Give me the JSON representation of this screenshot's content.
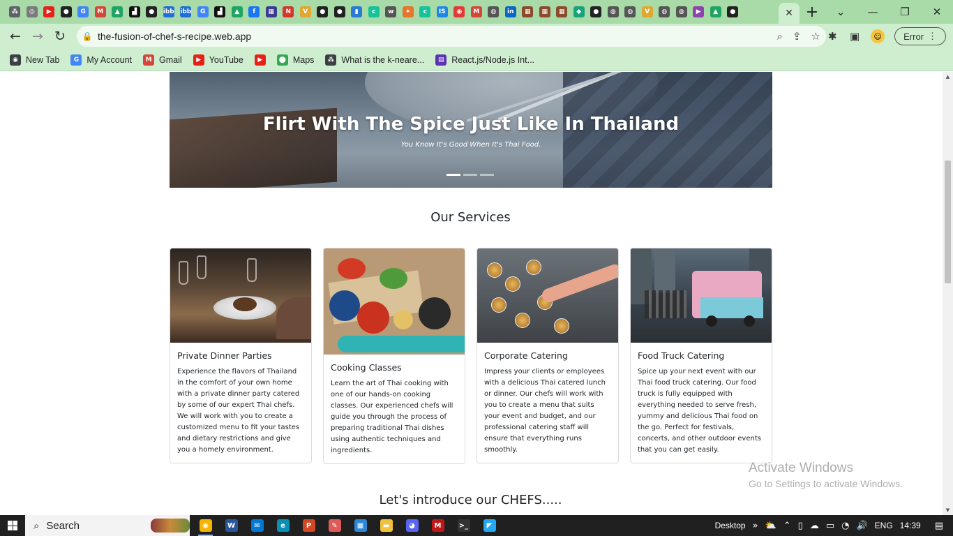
{
  "browser": {
    "url": "the-fusion-of-chef-s-recipe.web.app",
    "profile_button": "Error",
    "tab_icons": [
      {
        "name": "dots-icon",
        "color": "#5f6368",
        "glyph": "⁂"
      },
      {
        "name": "openai-icon",
        "color": "#7a7a7a",
        "glyph": "◎"
      },
      {
        "name": "youtube-icon",
        "color": "#e62117",
        "glyph": "▶"
      },
      {
        "name": "github-icon",
        "color": "#222222",
        "glyph": "●"
      },
      {
        "name": "google-icon",
        "color": "#4285f4",
        "glyph": "G"
      },
      {
        "name": "gmail-icon",
        "color": "#d44638",
        "glyph": "M"
      },
      {
        "name": "drive-icon",
        "color": "#1fa463",
        "glyph": "▲"
      },
      {
        "name": "codeforces-icon",
        "color": "#111111",
        "glyph": "▟"
      },
      {
        "name": "github-icon",
        "color": "#222222",
        "glyph": "●"
      },
      {
        "name": "imgbb-icon",
        "color": "#1f6fd6",
        "glyph": "ibb"
      },
      {
        "name": "imgbb-icon",
        "color": "#1f6fd6",
        "glyph": "ibb"
      },
      {
        "name": "google-icon",
        "color": "#4285f4",
        "glyph": "G"
      },
      {
        "name": "codeforces-icon",
        "color": "#111111",
        "glyph": "▟"
      },
      {
        "name": "drive-icon",
        "color": "#1fa463",
        "glyph": "▲"
      },
      {
        "name": "facebook-icon",
        "color": "#1877f2",
        "glyph": "f"
      },
      {
        "name": "app-icon",
        "color": "#3b3b8f",
        "glyph": "▦"
      },
      {
        "name": "notion-icon",
        "color": "#d6352b",
        "glyph": "N"
      },
      {
        "name": "vercel-icon",
        "color": "#e0a82e",
        "glyph": "V"
      },
      {
        "name": "github-icon",
        "color": "#222222",
        "glyph": "●"
      },
      {
        "name": "github-icon",
        "color": "#222222",
        "glyph": "●"
      },
      {
        "name": "book-icon",
        "color": "#2b7bd6",
        "glyph": "▮"
      },
      {
        "name": "grammarly-icon",
        "color": "#15c39a",
        "glyph": "c"
      },
      {
        "name": "wiki-icon",
        "color": "#555555",
        "glyph": "w"
      },
      {
        "name": "star-icon",
        "color": "#e6742b",
        "glyph": "✶"
      },
      {
        "name": "grammarly-icon",
        "color": "#15c39a",
        "glyph": "c"
      },
      {
        "name": "is-icon",
        "color": "#1e88e5",
        "glyph": "IS"
      },
      {
        "name": "record-icon",
        "color": "#e53935",
        "glyph": "◉"
      },
      {
        "name": "gmail-icon",
        "color": "#d44638",
        "glyph": "M"
      },
      {
        "name": "netlify-icon",
        "color": "#555555",
        "glyph": "◍"
      },
      {
        "name": "linkedin-icon",
        "color": "#0a66c2",
        "glyph": "in"
      },
      {
        "name": "app-icon",
        "color": "#8a4b2b",
        "glyph": "▦"
      },
      {
        "name": "app-icon",
        "color": "#8a4b2b",
        "glyph": "▦"
      },
      {
        "name": "app-icon",
        "color": "#8a4b2b",
        "glyph": "▦"
      },
      {
        "name": "diamond-icon",
        "color": "#1aa37a",
        "glyph": "◆"
      },
      {
        "name": "github-icon",
        "color": "#222222",
        "glyph": "●"
      },
      {
        "name": "netlify-icon",
        "color": "#555555",
        "glyph": "◍"
      },
      {
        "name": "netlify-icon",
        "color": "#555555",
        "glyph": "◍"
      },
      {
        "name": "vercel-icon",
        "color": "#e0a82e",
        "glyph": "V"
      },
      {
        "name": "netlify-icon",
        "color": "#555555",
        "glyph": "◍"
      },
      {
        "name": "netlify-icon",
        "color": "#555555",
        "glyph": "◍"
      },
      {
        "name": "play-icon",
        "color": "#8e44ad",
        "glyph": "▶"
      },
      {
        "name": "drive-icon",
        "color": "#1fa463",
        "glyph": "▲"
      },
      {
        "name": "github-icon",
        "color": "#222222",
        "glyph": "●"
      }
    ],
    "bookmarks": [
      {
        "label": "New Tab",
        "icon": "globe-icon",
        "color": "#3c4043",
        "glyph": "◉"
      },
      {
        "label": "My Account",
        "icon": "google-icon",
        "color": "#4285f4",
        "glyph": "G"
      },
      {
        "label": "Gmail",
        "icon": "gmail-icon",
        "color": "#d44638",
        "glyph": "M"
      },
      {
        "label": "YouTube",
        "icon": "youtube-icon",
        "color": "#e62117",
        "glyph": "▶"
      },
      {
        "label": "",
        "icon": "youtube-icon",
        "color": "#e62117",
        "glyph": "▶"
      },
      {
        "label": "Maps",
        "icon": "maps-icon",
        "color": "#34a853",
        "glyph": "⬤"
      },
      {
        "label": "What is the k-neare...",
        "icon": "network-icon",
        "color": "#3c4043",
        "glyph": "⁂"
      },
      {
        "label": "React.js/Node.js Int...",
        "icon": "app-icon",
        "color": "#5e35b1",
        "glyph": "▤"
      }
    ]
  },
  "hero": {
    "title": "Flirt With The Spice Just Like In Thailand",
    "subtitle": "You Know It's Good When It's Thai Food.",
    "slides": 3,
    "active_slide": 1
  },
  "services": {
    "title": "Our Services",
    "cards": [
      {
        "title": "Private Dinner Parties",
        "text": "Experience the flavors of Thailand in the comfort of your own home with a private dinner party catered by some of our expert Thai chefs. We will work with you to create a customized menu to fit your tastes and dietary restrictions and give you a homely environment."
      },
      {
        "title": "Cooking Classes",
        "text": "Learn the art of Thai cooking with one of our hands-on cooking classes. Our experienced chefs will guide you through the process of preparing traditional Thai dishes using authentic techniques and ingredients."
      },
      {
        "title": "Corporate Catering",
        "text": "Impress your clients or employees with a delicious Thai catered lunch or dinner. Our chefs will work with you to create a menu that suits your event and budget, and our professional catering staff will ensure that everything runs smoothly."
      },
      {
        "title": "Food Truck Catering",
        "text": "Spice up your next event with our Thai food truck catering. Our food truck is fully equipped with everything needed to serve fresh, yummy and delicious Thai food on the go. Perfect for festivals, concerts, and other outdoor events that you can get easily."
      }
    ]
  },
  "chefs": {
    "title": "Let's introduce our CHEFS....."
  },
  "watermark": {
    "line1": "Activate Windows",
    "line2": "Go to Settings to activate Windows."
  },
  "taskbar": {
    "search_label": "Search",
    "desktop_label": "Desktop",
    "language": "ENG",
    "time": "14:39",
    "apps": [
      {
        "name": "chrome-icon",
        "color": "#f4b400",
        "glyph": "◉",
        "active": true
      },
      {
        "name": "word-icon",
        "color": "#2b579a",
        "glyph": "W",
        "active": false
      },
      {
        "name": "mail-icon",
        "color": "#0078d4",
        "glyph": "✉",
        "active": false
      },
      {
        "name": "edge-icon",
        "color": "#0a8fb5",
        "glyph": "e",
        "active": false
      },
      {
        "name": "powerpoint-icon",
        "color": "#d24726",
        "glyph": "P",
        "active": false
      },
      {
        "name": "paint-icon",
        "color": "#e05a5a",
        "glyph": "✎",
        "active": false
      },
      {
        "name": "store-icon",
        "color": "#2b88d8",
        "glyph": "▦",
        "active": false
      },
      {
        "name": "explorer-icon",
        "color": "#f2c23b",
        "glyph": "▬",
        "active": false
      },
      {
        "name": "discord-icon",
        "color": "#5865f2",
        "glyph": "◕",
        "active": false
      },
      {
        "name": "mcafee-icon",
        "color": "#c01818",
        "glyph": "M",
        "active": false
      },
      {
        "name": "terminal-icon",
        "color": "#333333",
        "glyph": ">_",
        "active": false
      },
      {
        "name": "vscode-icon",
        "color": "#23a9f2",
        "glyph": "◤",
        "active": false
      }
    ]
  }
}
